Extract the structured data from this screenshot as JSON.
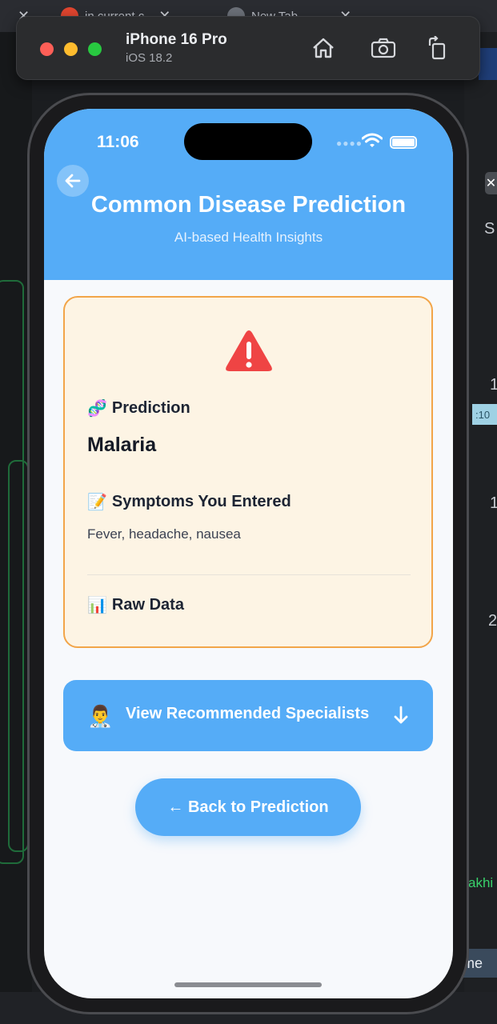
{
  "host": {
    "tab1_title": "in current c",
    "tab2_title": "New Tab",
    "right_letter": "S",
    "right_numbers": [
      "1",
      "1",
      "2"
    ],
    "right_badge": ":10",
    "right_green_text": "akhi",
    "right_button_label": "me"
  },
  "simulator": {
    "device_name": "iPhone 16 Pro",
    "os_version": "iOS 18.2",
    "icons": [
      "home-icon",
      "screenshot-icon",
      "rotate-icon"
    ]
  },
  "status_bar": {
    "time": "11:06"
  },
  "header": {
    "title": "Common Disease Prediction",
    "subtitle": "AI-based Health Insights"
  },
  "result": {
    "prediction_label": "Prediction",
    "prediction_emoji": "🧬",
    "prediction_value": "Malaria",
    "symptoms_label": "Symptoms You Entered",
    "symptoms_emoji": "📝",
    "symptoms_value": "Fever, headache, nausea",
    "raw_data_label": "Raw Data",
    "raw_data_emoji": "📊"
  },
  "actions": {
    "specialists_label": "View Recommended Specialists",
    "specialists_emoji": "👨‍⚕️",
    "back_label": "← Back to Prediction"
  },
  "colors": {
    "primary": "#55acf7",
    "card_bg": "#fdf4e4",
    "card_border": "#f2a549",
    "warning": "#ef4444"
  }
}
